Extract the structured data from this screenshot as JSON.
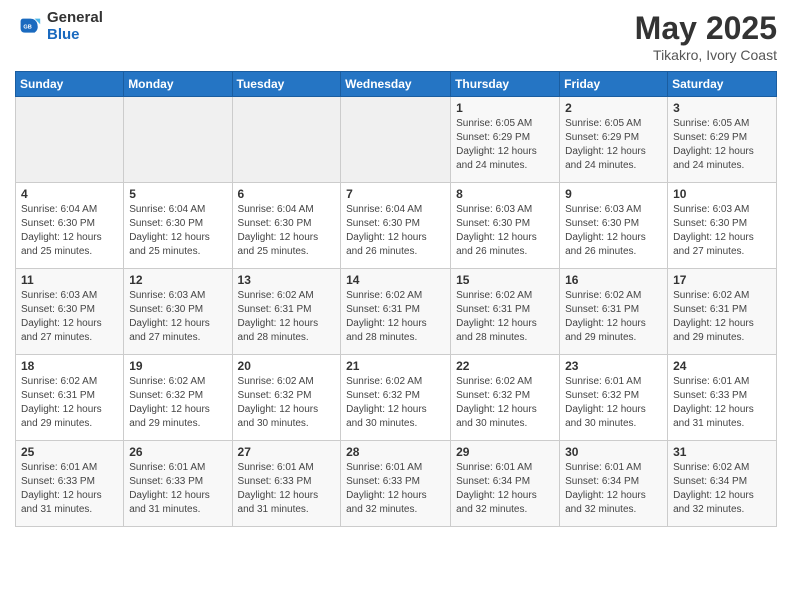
{
  "header": {
    "logo_general": "General",
    "logo_blue": "Blue",
    "main_title": "May 2025",
    "subtitle": "Tikakro, Ivory Coast"
  },
  "calendar": {
    "days_of_week": [
      "Sunday",
      "Monday",
      "Tuesday",
      "Wednesday",
      "Thursday",
      "Friday",
      "Saturday"
    ],
    "weeks": [
      [
        {
          "day": "",
          "info": ""
        },
        {
          "day": "",
          "info": ""
        },
        {
          "day": "",
          "info": ""
        },
        {
          "day": "",
          "info": ""
        },
        {
          "day": "1",
          "info": "Sunrise: 6:05 AM\nSunset: 6:29 PM\nDaylight: 12 hours\nand 24 minutes."
        },
        {
          "day": "2",
          "info": "Sunrise: 6:05 AM\nSunset: 6:29 PM\nDaylight: 12 hours\nand 24 minutes."
        },
        {
          "day": "3",
          "info": "Sunrise: 6:05 AM\nSunset: 6:29 PM\nDaylight: 12 hours\nand 24 minutes."
        }
      ],
      [
        {
          "day": "4",
          "info": "Sunrise: 6:04 AM\nSunset: 6:30 PM\nDaylight: 12 hours\nand 25 minutes."
        },
        {
          "day": "5",
          "info": "Sunrise: 6:04 AM\nSunset: 6:30 PM\nDaylight: 12 hours\nand 25 minutes."
        },
        {
          "day": "6",
          "info": "Sunrise: 6:04 AM\nSunset: 6:30 PM\nDaylight: 12 hours\nand 25 minutes."
        },
        {
          "day": "7",
          "info": "Sunrise: 6:04 AM\nSunset: 6:30 PM\nDaylight: 12 hours\nand 26 minutes."
        },
        {
          "day": "8",
          "info": "Sunrise: 6:03 AM\nSunset: 6:30 PM\nDaylight: 12 hours\nand 26 minutes."
        },
        {
          "day": "9",
          "info": "Sunrise: 6:03 AM\nSunset: 6:30 PM\nDaylight: 12 hours\nand 26 minutes."
        },
        {
          "day": "10",
          "info": "Sunrise: 6:03 AM\nSunset: 6:30 PM\nDaylight: 12 hours\nand 27 minutes."
        }
      ],
      [
        {
          "day": "11",
          "info": "Sunrise: 6:03 AM\nSunset: 6:30 PM\nDaylight: 12 hours\nand 27 minutes."
        },
        {
          "day": "12",
          "info": "Sunrise: 6:03 AM\nSunset: 6:30 PM\nDaylight: 12 hours\nand 27 minutes."
        },
        {
          "day": "13",
          "info": "Sunrise: 6:02 AM\nSunset: 6:31 PM\nDaylight: 12 hours\nand 28 minutes."
        },
        {
          "day": "14",
          "info": "Sunrise: 6:02 AM\nSunset: 6:31 PM\nDaylight: 12 hours\nand 28 minutes."
        },
        {
          "day": "15",
          "info": "Sunrise: 6:02 AM\nSunset: 6:31 PM\nDaylight: 12 hours\nand 28 minutes."
        },
        {
          "day": "16",
          "info": "Sunrise: 6:02 AM\nSunset: 6:31 PM\nDaylight: 12 hours\nand 29 minutes."
        },
        {
          "day": "17",
          "info": "Sunrise: 6:02 AM\nSunset: 6:31 PM\nDaylight: 12 hours\nand 29 minutes."
        }
      ],
      [
        {
          "day": "18",
          "info": "Sunrise: 6:02 AM\nSunset: 6:31 PM\nDaylight: 12 hours\nand 29 minutes."
        },
        {
          "day": "19",
          "info": "Sunrise: 6:02 AM\nSunset: 6:32 PM\nDaylight: 12 hours\nand 29 minutes."
        },
        {
          "day": "20",
          "info": "Sunrise: 6:02 AM\nSunset: 6:32 PM\nDaylight: 12 hours\nand 30 minutes."
        },
        {
          "day": "21",
          "info": "Sunrise: 6:02 AM\nSunset: 6:32 PM\nDaylight: 12 hours\nand 30 minutes."
        },
        {
          "day": "22",
          "info": "Sunrise: 6:02 AM\nSunset: 6:32 PM\nDaylight: 12 hours\nand 30 minutes."
        },
        {
          "day": "23",
          "info": "Sunrise: 6:01 AM\nSunset: 6:32 PM\nDaylight: 12 hours\nand 30 minutes."
        },
        {
          "day": "24",
          "info": "Sunrise: 6:01 AM\nSunset: 6:33 PM\nDaylight: 12 hours\nand 31 minutes."
        }
      ],
      [
        {
          "day": "25",
          "info": "Sunrise: 6:01 AM\nSunset: 6:33 PM\nDaylight: 12 hours\nand 31 minutes."
        },
        {
          "day": "26",
          "info": "Sunrise: 6:01 AM\nSunset: 6:33 PM\nDaylight: 12 hours\nand 31 minutes."
        },
        {
          "day": "27",
          "info": "Sunrise: 6:01 AM\nSunset: 6:33 PM\nDaylight: 12 hours\nand 31 minutes."
        },
        {
          "day": "28",
          "info": "Sunrise: 6:01 AM\nSunset: 6:33 PM\nDaylight: 12 hours\nand 32 minutes."
        },
        {
          "day": "29",
          "info": "Sunrise: 6:01 AM\nSunset: 6:34 PM\nDaylight: 12 hours\nand 32 minutes."
        },
        {
          "day": "30",
          "info": "Sunrise: 6:01 AM\nSunset: 6:34 PM\nDaylight: 12 hours\nand 32 minutes."
        },
        {
          "day": "31",
          "info": "Sunrise: 6:02 AM\nSunset: 6:34 PM\nDaylight: 12 hours\nand 32 minutes."
        }
      ]
    ]
  }
}
